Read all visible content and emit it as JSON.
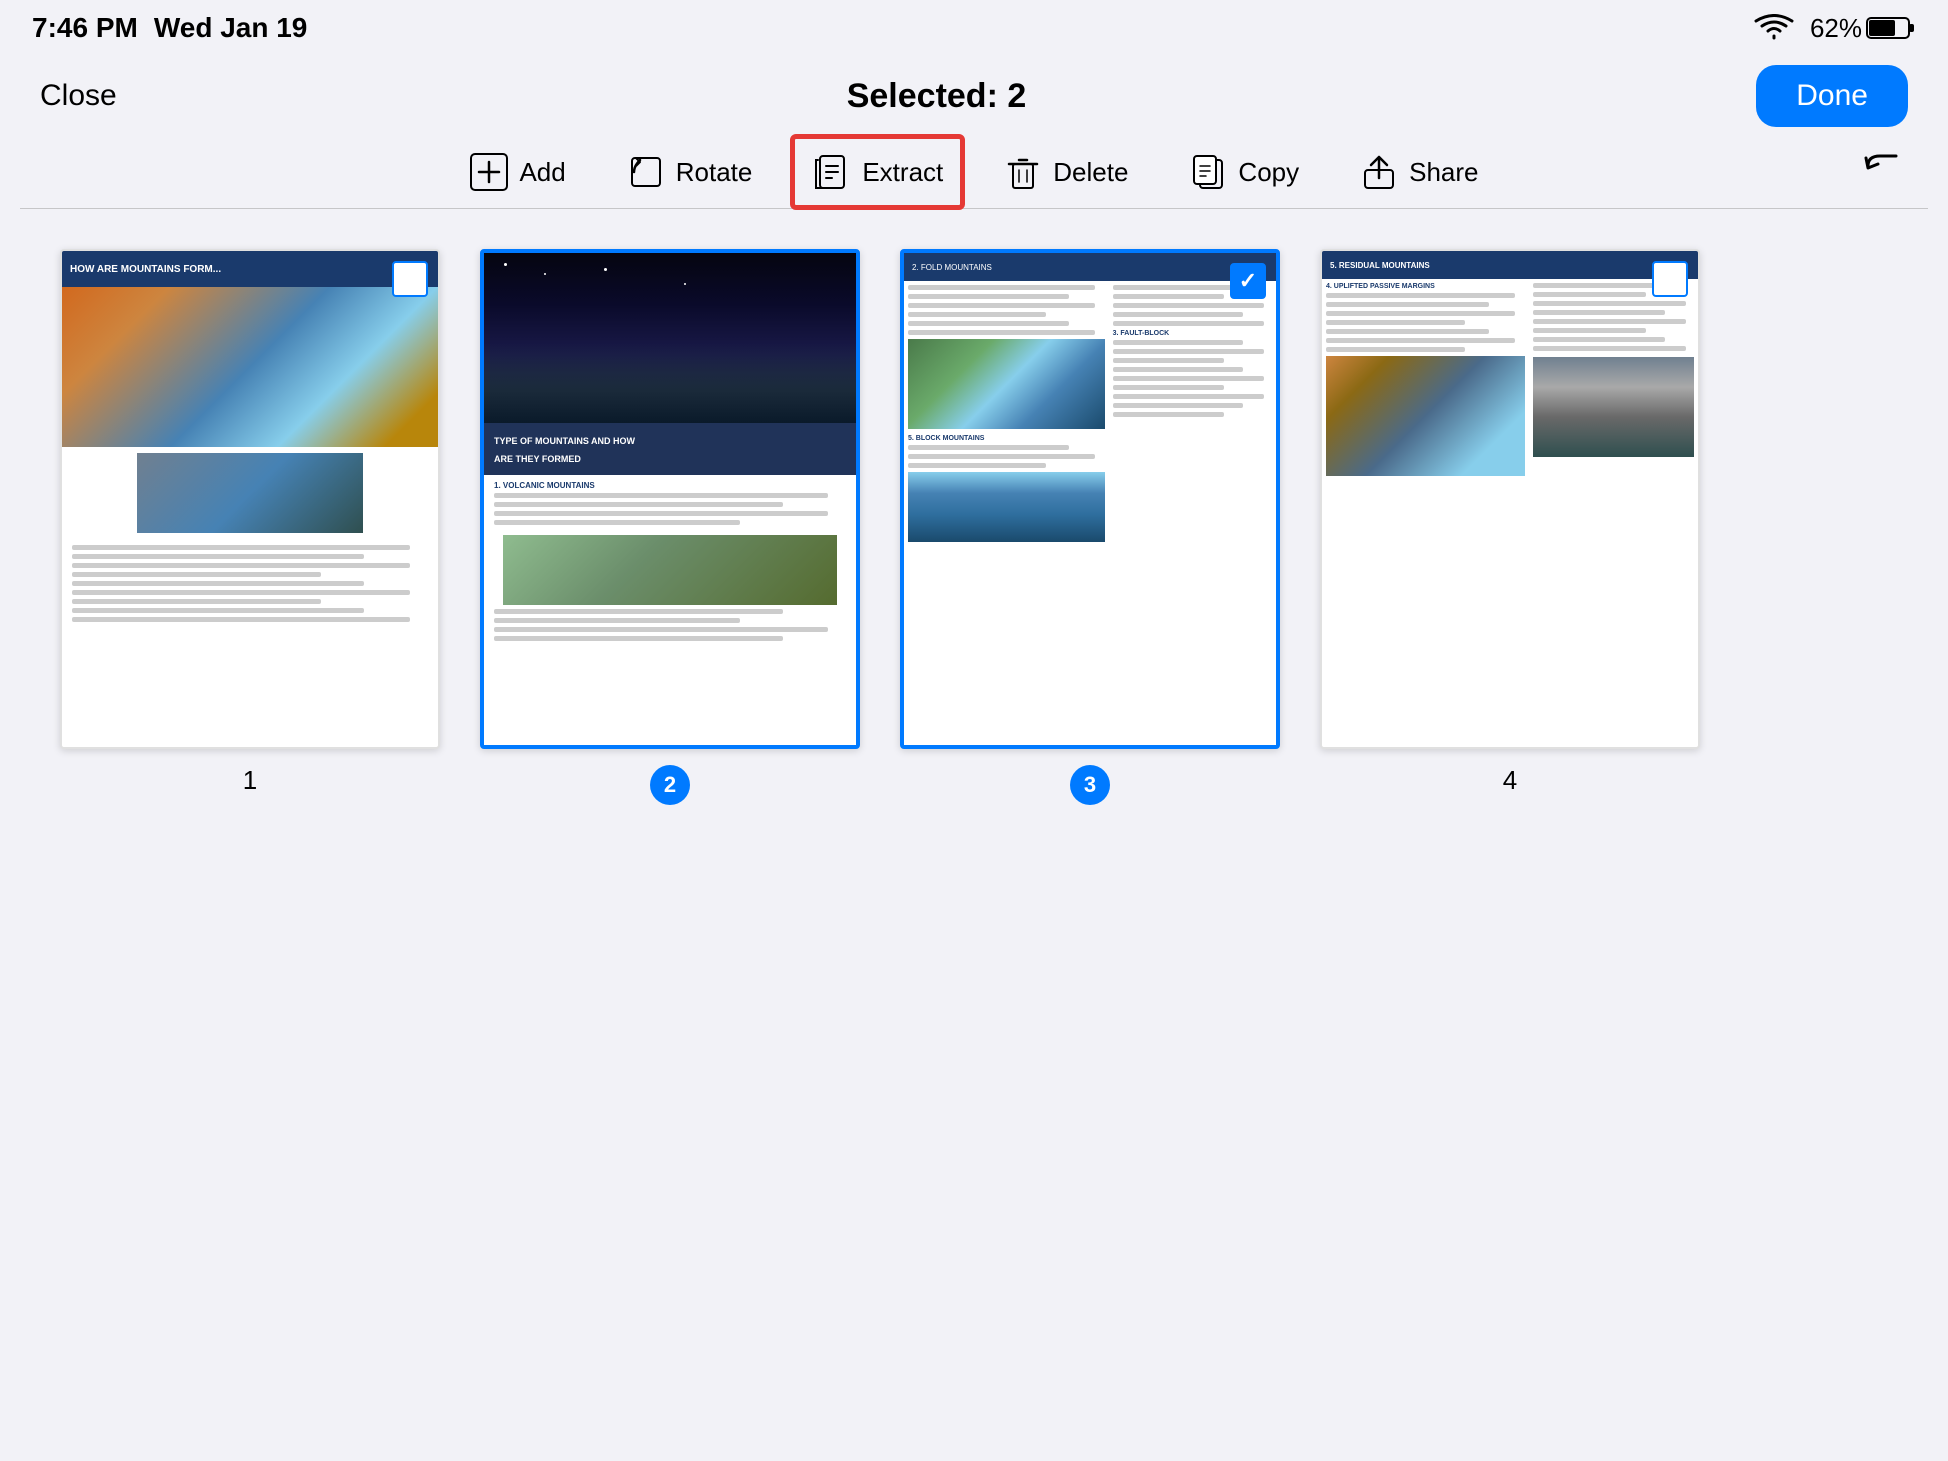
{
  "statusBar": {
    "time": "7:46 PM",
    "date": "Wed Jan 19",
    "wifi": "wifi-icon",
    "battery": "62%"
  },
  "nav": {
    "close_label": "Close",
    "title": "Selected: 2",
    "done_label": "Done"
  },
  "toolbar": {
    "add_label": "Add",
    "rotate_label": "Rotate",
    "extract_label": "Extract",
    "delete_label": "Delete",
    "copy_label": "Copy",
    "share_label": "Share"
  },
  "pages": [
    {
      "number": "1",
      "badge_type": "plain",
      "selected": false,
      "checkbox_checked": false
    },
    {
      "number": "2",
      "badge_type": "badge",
      "selected": true,
      "checkbox_checked": true
    },
    {
      "number": "3",
      "badge_type": "badge",
      "selected": true,
      "checkbox_checked": true
    },
    {
      "number": "4",
      "badge_type": "plain",
      "selected": false,
      "checkbox_checked": false
    }
  ]
}
